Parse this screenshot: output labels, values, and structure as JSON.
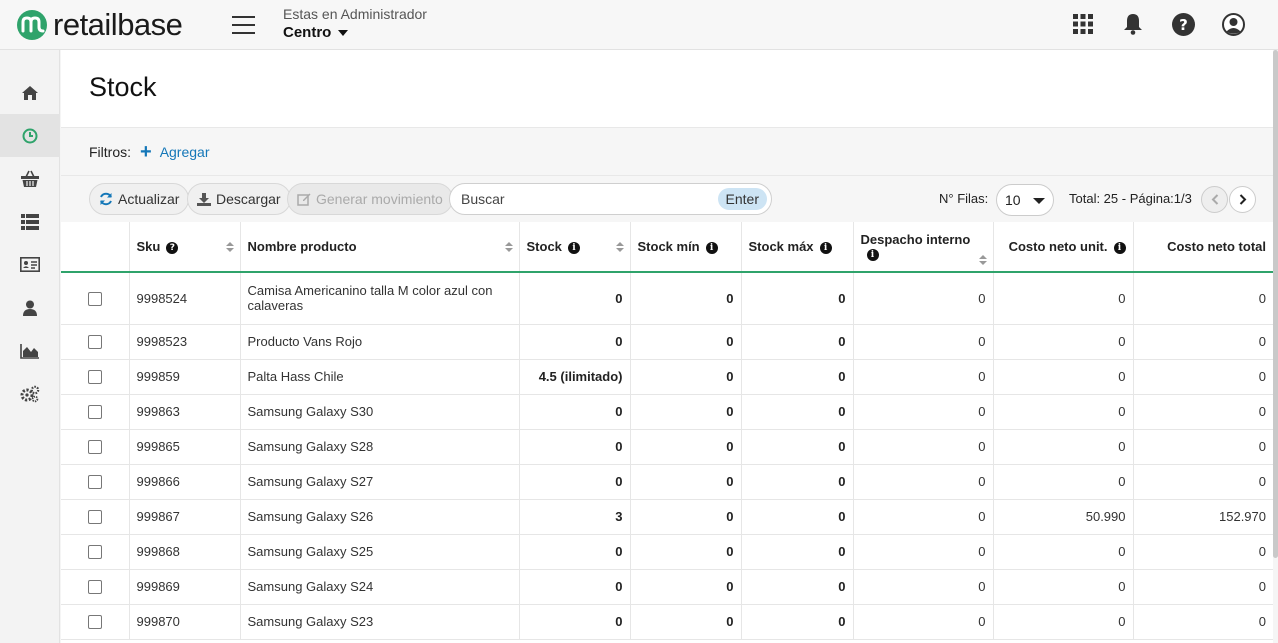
{
  "brand": {
    "name": "retailbase",
    "color": "#2fa36b"
  },
  "header": {
    "admin_caption": "Estas en Administrador",
    "admin_value": "Centro",
    "icons": [
      "apps-grid-icon",
      "bell-icon",
      "help-icon",
      "user-account-icon"
    ]
  },
  "sidebar": {
    "items": [
      {
        "icon": "home-icon",
        "active": false
      },
      {
        "icon": "clock-icon",
        "active": true
      },
      {
        "icon": "basket-icon",
        "active": false
      },
      {
        "icon": "list-icon",
        "active": false
      },
      {
        "icon": "id-card-icon",
        "active": false
      },
      {
        "icon": "user-icon",
        "active": false
      },
      {
        "icon": "area-chart-icon",
        "active": false
      },
      {
        "icon": "settings-icon",
        "active": false
      }
    ]
  },
  "page": {
    "title": "Stock",
    "filters_label": "Filtros:",
    "add_filter_label": "Agregar"
  },
  "toolbar": {
    "refresh_label": "Actualizar",
    "download_label": "Descargar",
    "generate_label": "Generar movimiento",
    "search_placeholder": "Buscar",
    "enter_label": "Enter",
    "rows_label": "N° Filas:",
    "rows_value": "10",
    "pager_text": "Total: 25 - Página:1/3"
  },
  "table": {
    "columns": [
      "Sku",
      "Nombre producto",
      "Stock",
      "Stock mín",
      "Stock máx",
      "Despacho interno",
      "Costo neto unit.",
      "Costo neto total"
    ],
    "rows": [
      [
        "9998524",
        "Camisa Americanino talla M color azul con calaveras",
        "0",
        "0",
        "0",
        "0",
        "0",
        "0"
      ],
      [
        "9998523",
        "Producto Vans Rojo",
        "0",
        "0",
        "0",
        "0",
        "0",
        "0"
      ],
      [
        "999859",
        "Palta Hass Chile",
        "4.5 (ilimitado)",
        "0",
        "0",
        "0",
        "0",
        "0"
      ],
      [
        "999863",
        "Samsung Galaxy S30",
        "0",
        "0",
        "0",
        "0",
        "0",
        "0"
      ],
      [
        "999865",
        "Samsung Galaxy S28",
        "0",
        "0",
        "0",
        "0",
        "0",
        "0"
      ],
      [
        "999866",
        "Samsung Galaxy S27",
        "0",
        "0",
        "0",
        "0",
        "0",
        "0"
      ],
      [
        "999867",
        "Samsung Galaxy S26",
        "3",
        "0",
        "0",
        "0",
        "50.990",
        "152.970"
      ],
      [
        "999868",
        "Samsung Galaxy S25",
        "0",
        "0",
        "0",
        "0",
        "0",
        "0"
      ],
      [
        "999869",
        "Samsung Galaxy S24",
        "0",
        "0",
        "0",
        "0",
        "0",
        "0"
      ],
      [
        "999870",
        "Samsung Galaxy S23",
        "0",
        "0",
        "0",
        "0",
        "0",
        "0"
      ]
    ]
  }
}
